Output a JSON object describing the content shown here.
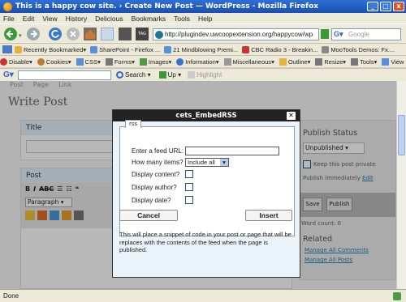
{
  "window": {
    "title": "This is a happy cow site. › Create New Post — WordPress - Mozilla Firefox"
  },
  "menu": [
    "File",
    "Edit",
    "View",
    "History",
    "Delicious",
    "Bookmarks",
    "Tools",
    "Help"
  ],
  "nav": {
    "url": "http://plugindev.uwcoopextension.org/happycow/wp",
    "search_placeholder": "Google"
  },
  "bookmarks": [
    {
      "label": "Recently Bookmarked",
      "icon": "star-folder-icon",
      "color": "#e8b23a"
    },
    {
      "label": "SharePoint - Firefox ...",
      "icon": "page-icon",
      "color": "#5b8fd9"
    },
    {
      "label": "21 Mindblowing Premi...",
      "icon": "page-icon",
      "color": "#5b8fd9"
    },
    {
      "label": "CBC Radio 3 - Breakin...",
      "icon": "page-icon",
      "color": "#c33"
    },
    {
      "label": "MooTools Demos: Fx....",
      "icon": "page-icon",
      "color": "#888"
    }
  ],
  "devtools": [
    {
      "label": "Disable",
      "color": "#c33"
    },
    {
      "label": "Cookies",
      "color": "#b97a3a"
    },
    {
      "label": "CSS",
      "color": "#5b8fd9"
    },
    {
      "label": "Forms",
      "color": "#777"
    },
    {
      "label": "Images",
      "color": "#4a9a4a"
    },
    {
      "label": "Information",
      "color": "#3a6fc9"
    },
    {
      "label": "Miscellaneous",
      "color": "#999"
    },
    {
      "label": "Outline",
      "color": "#e8b23a"
    },
    {
      "label": "Resize",
      "color": "#777"
    },
    {
      "label": "Tools",
      "color": "#777"
    },
    {
      "label": "View Source",
      "color": "#5b8fd9"
    }
  ],
  "toolbar4": {
    "search_label": "Search",
    "up_label": "Up",
    "highlight_label": "Highlight"
  },
  "page": {
    "links": [
      "Post",
      "Page",
      "Link"
    ],
    "heading": "Write Post",
    "title_box": "Title",
    "post_box": "Post",
    "format_value": "Paragraph",
    "publish_status": "Publish Status",
    "status_value": "Unpublished",
    "keep_private": "Keep this post private",
    "publish_immediately": "Publish immediately",
    "edit_link": "Edit",
    "save_button": "Save",
    "publish_button": "Publish",
    "word_count": "Word count: 0",
    "related": "Related",
    "manage_comments": "Manage All Comments",
    "manage_posts": "Manage All Posts"
  },
  "modal": {
    "title": "cets_EmbedRSS",
    "close": "✕",
    "tab": "rss",
    "feed_label": "Enter a feed URL:",
    "feed_value": "",
    "items_label": "How many items?",
    "items_value": "Include all",
    "content_label": "Display content?",
    "author_label": "Display author?",
    "date_label": "Display date?",
    "cancel": "Cancel",
    "insert": "Insert",
    "description": "This will place a snippet of code in your post or page that will be replaces with the contents of the feed when the page is published."
  },
  "status": {
    "text": "Done"
  }
}
